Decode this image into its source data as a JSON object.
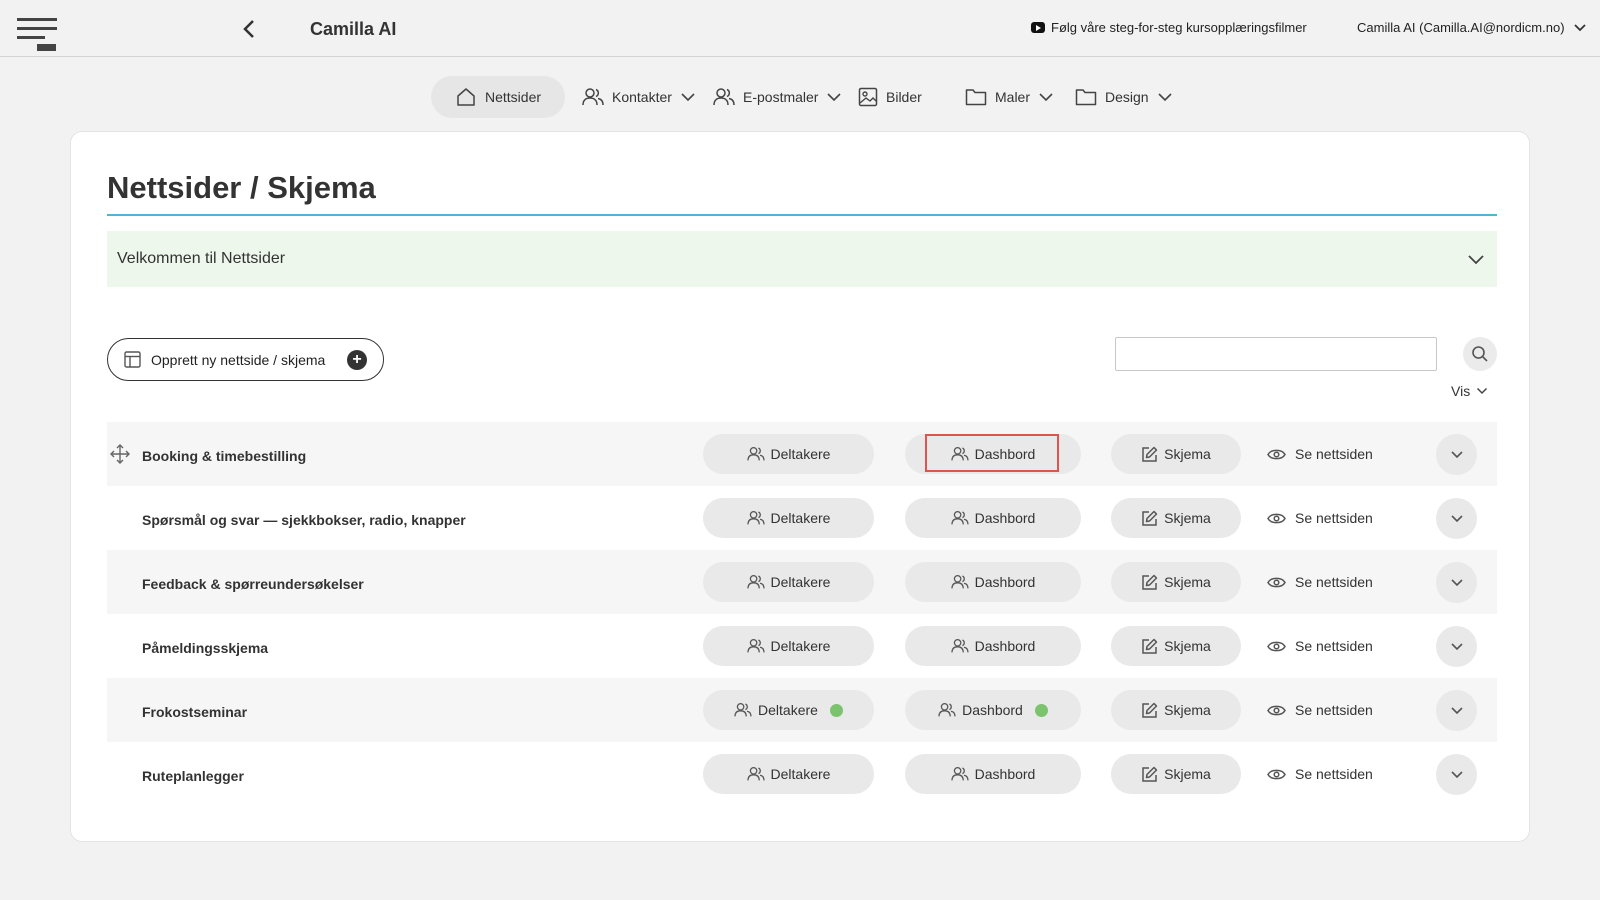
{
  "header": {
    "app_title": "Camilla AI",
    "tutorial_link": "Følg våre steg-for-steg kursopplæringsfilmer",
    "user": "Camilla AI (Camilla.AI@nordicm.no)"
  },
  "nav": {
    "items": [
      {
        "label": "Nettsider",
        "active": true
      },
      {
        "label": "Kontakter"
      },
      {
        "label": "E-postmaler"
      },
      {
        "label": "Bilder"
      },
      {
        "label": "Maler"
      },
      {
        "label": "Design"
      }
    ]
  },
  "main": {
    "title": "Nettsider / Skjema",
    "welcome": "Velkommen til Nettsider",
    "create_button": "Opprett ny nettside / skjema",
    "search_value": "",
    "vis_label": "Vis"
  },
  "row_actions": {
    "participants": "Deltakere",
    "dashboard": "Dashbord",
    "form": "Skjema",
    "view_site": "Se nettsiden"
  },
  "rows": [
    {
      "name": "Booking & timebestilling",
      "participants_indicator": false,
      "dashboard_indicator": false
    },
    {
      "name": "Spørsmål og svar — sjekkbokser, radio, knapper",
      "participants_indicator": false,
      "dashboard_indicator": false
    },
    {
      "name": "Feedback & spørreundersøkelser",
      "participants_indicator": false,
      "dashboard_indicator": false
    },
    {
      "name": "Påmeldingsskjema",
      "participants_indicator": false,
      "dashboard_indicator": false
    },
    {
      "name": "Frokostseminar",
      "participants_indicator": true,
      "dashboard_indicator": true
    },
    {
      "name": "Ruteplanlegger",
      "participants_indicator": false,
      "dashboard_indicator": false
    }
  ],
  "colors": {
    "accent_rule": "#4db6d4",
    "welcome_bg": "#eef7ec",
    "indicator": "#7cc36e",
    "highlight": "#e0534f"
  }
}
